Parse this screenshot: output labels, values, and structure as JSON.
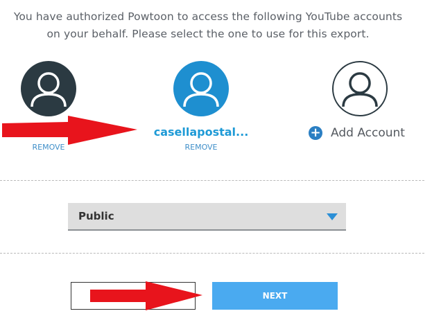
{
  "intro": {
    "line1": "You have authorized Powtoon to access the following YouTube accounts",
    "line2": "on your behalf. Please select the one to use for this export."
  },
  "accounts": [
    {
      "name": "",
      "remove_label": "REMOVE",
      "color": "#2b3a42"
    },
    {
      "name": "casellapostal...",
      "remove_label": "REMOVE",
      "color": "#1e8fd0"
    }
  ],
  "add_account": {
    "icon": "plus-circle-icon",
    "label": "Add Account"
  },
  "privacy_select": {
    "value": "Public"
  },
  "buttons": {
    "back_label": "",
    "next_label": "NEXT"
  },
  "annotations": {
    "arrow_color": "#e8141c"
  }
}
